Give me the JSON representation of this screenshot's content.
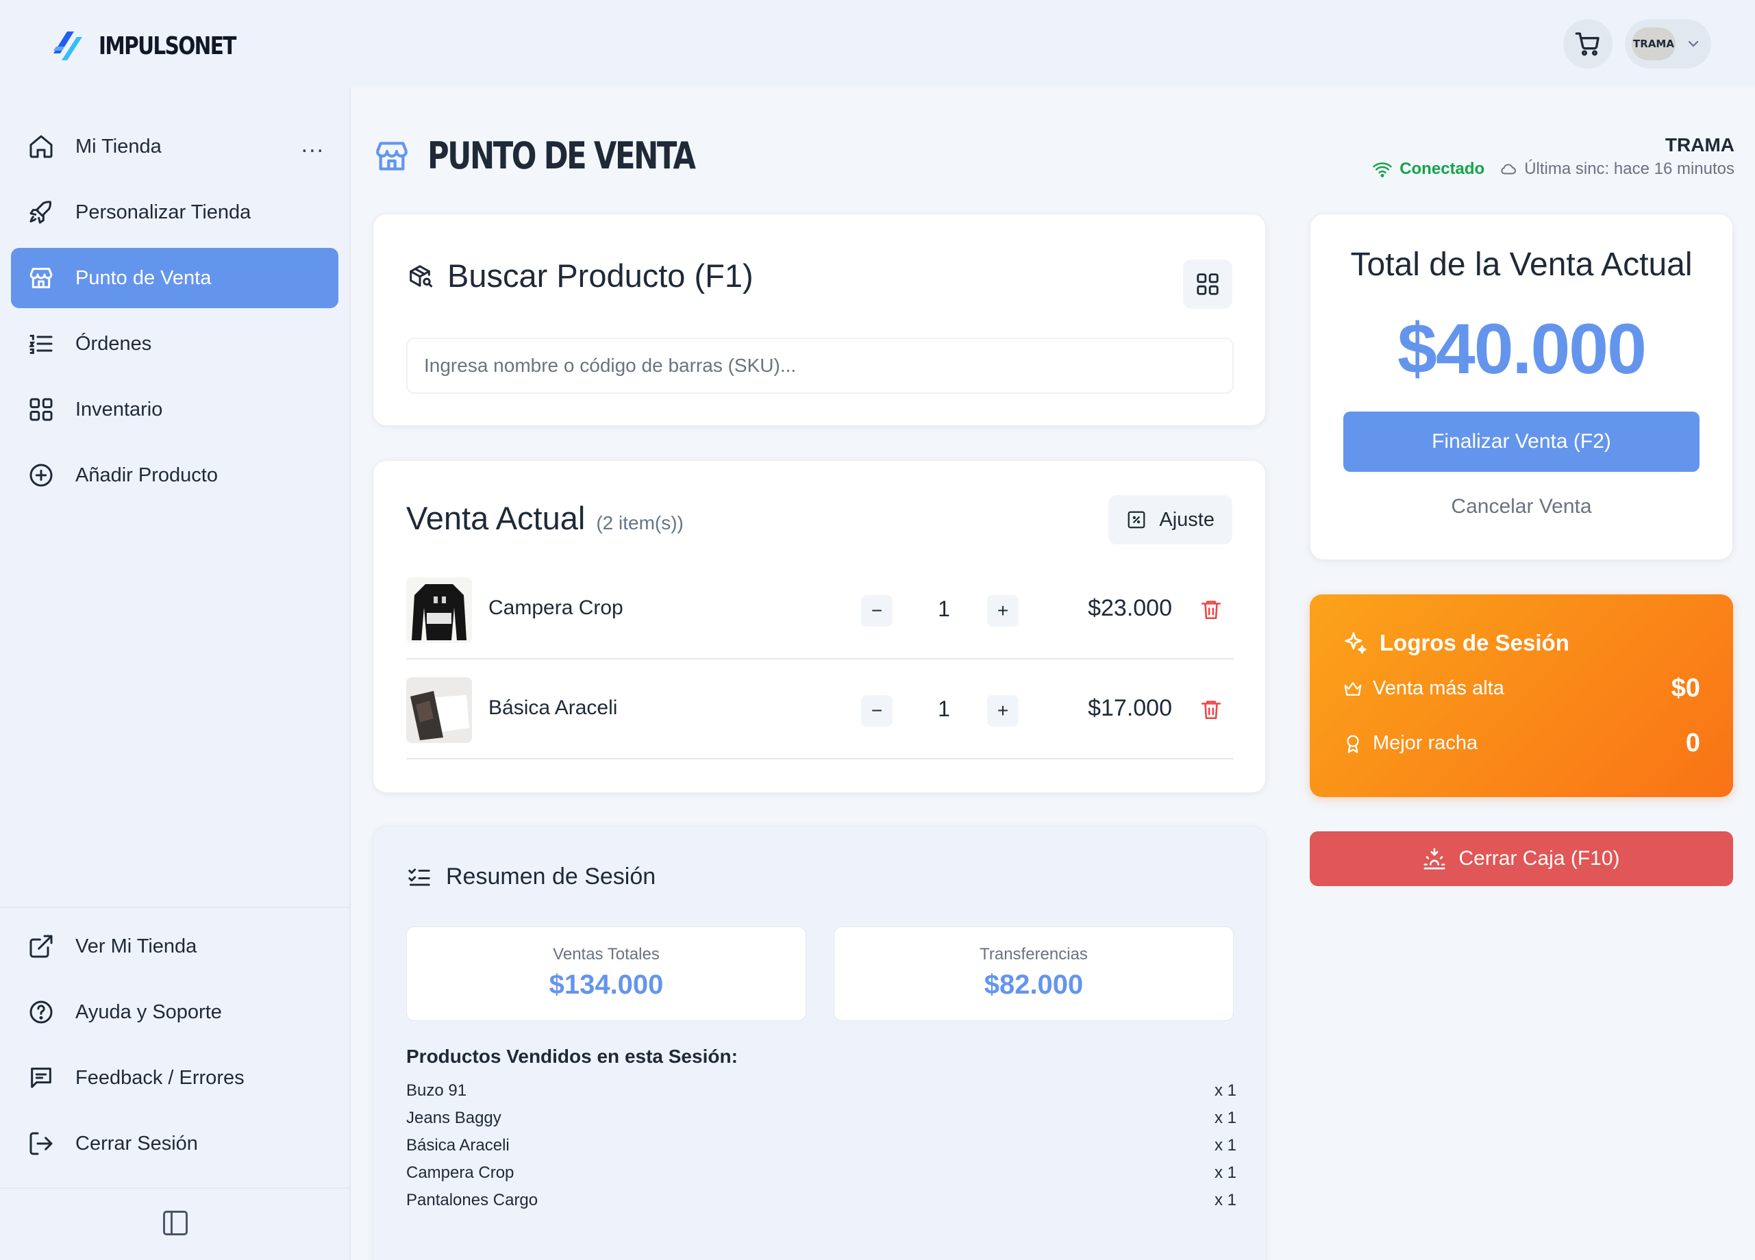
{
  "brand": {
    "name": "IMPULSONET",
    "avatar_text": "TRAMA"
  },
  "sidebar": {
    "items": [
      {
        "label": "Mi Tienda"
      },
      {
        "label": "Personalizar Tienda"
      },
      {
        "label": "Punto de Venta"
      },
      {
        "label": "Órdenes"
      },
      {
        "label": "Inventario"
      },
      {
        "label": "Añadir Producto"
      }
    ],
    "more_label": "...",
    "bottom_items": [
      {
        "label": "Ver Mi Tienda"
      },
      {
        "label": "Ayuda y Soporte"
      },
      {
        "label": "Feedback / Errores"
      },
      {
        "label": "Cerrar Sesión"
      }
    ]
  },
  "header": {
    "title": "PUNTO DE VENTA",
    "store_name": "TRAMA",
    "status": "Conectado",
    "sync": "Última sinc: hace 16 minutos"
  },
  "search": {
    "title": "Buscar Producto (F1)",
    "placeholder": "Ingresa nombre o código de barras (SKU)..."
  },
  "sale": {
    "title": "Venta Actual",
    "count": "(2 item(s))",
    "adjust_label": "Ajuste",
    "items": [
      {
        "name": "Campera Crop",
        "qty": "1",
        "price": "$23.000"
      },
      {
        "name": "Básica Araceli",
        "qty": "1",
        "price": "$17.000"
      }
    ],
    "minus": "−",
    "plus": "+"
  },
  "summary": {
    "title": "Resumen de Sesión",
    "stats": [
      {
        "label": "Ventas Totales",
        "value": "$134.000"
      },
      {
        "label": "Transferencias",
        "value": "$82.000"
      }
    ],
    "sold_title": "Productos Vendidos en esta Sesión:",
    "sold": [
      {
        "name": "Buzo 91",
        "qty": "x 1"
      },
      {
        "name": "Jeans Baggy",
        "qty": "x 1"
      },
      {
        "name": "Básica Araceli",
        "qty": "x 1"
      },
      {
        "name": "Campera Crop",
        "qty": "x 1"
      },
      {
        "name": "Pantalones Cargo",
        "qty": "x 1"
      }
    ]
  },
  "total": {
    "title": "Total de la Venta Actual",
    "amount": "$40.000",
    "finalize_label": "Finalizar Venta (F2)",
    "cancel_label": "Cancelar Venta"
  },
  "logros": {
    "title": "Logros de Sesión",
    "rows": [
      {
        "label": "Venta más alta",
        "value": "$0"
      },
      {
        "label": "Mejor racha",
        "value": "0"
      }
    ]
  },
  "close_box": {
    "label": "Cerrar Caja (F10)"
  },
  "colors": {
    "accent": "#6495ed",
    "success": "#16a34a",
    "danger": "#e15656",
    "orange": "#f97316"
  },
  "icons": {
    "nav": [
      "home-icon",
      "rocket-icon",
      "store-icon",
      "list-icon",
      "grid-icon",
      "plus-circle-icon"
    ],
    "bottom": [
      "external-link-icon",
      "help-circle-icon",
      "message-square-icon",
      "log-out-icon"
    ]
  }
}
